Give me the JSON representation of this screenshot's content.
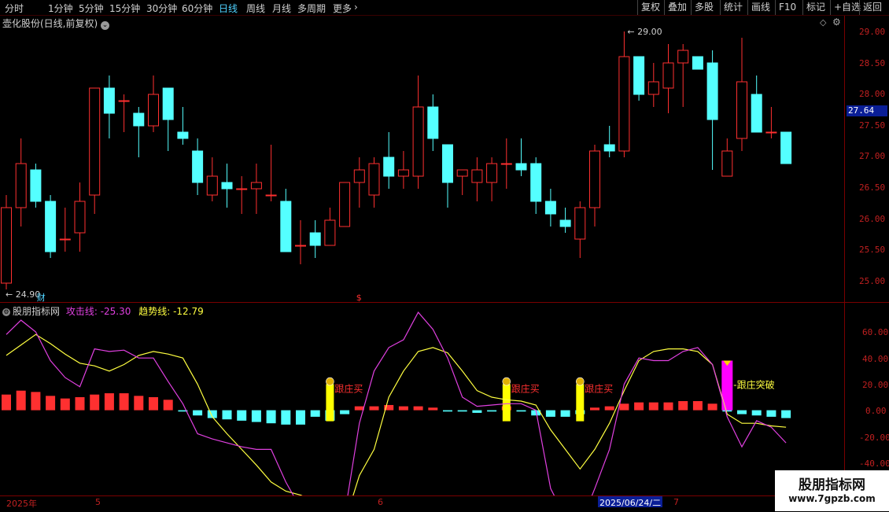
{
  "toolbar": {
    "periods": [
      "分时",
      "1分钟",
      "5分钟",
      "15分钟",
      "30分钟",
      "60分钟",
      "日线",
      "周线",
      "月线",
      "多周期",
      "更多"
    ],
    "active_period": "日线",
    "right_buttons": [
      "复权",
      "叠加",
      "多股",
      "统计",
      "画线",
      "F10",
      "标记",
      "+自选",
      "返回"
    ]
  },
  "chart_title": "壶化股份(日线,前复权)",
  "indicator": {
    "name": "股朋指标网",
    "attack_label": "攻击线: -25.30",
    "trend_label": "趋势线: -12.79",
    "signals": {
      "buy": "跟庄买",
      "breakout": "跟庄突破"
    }
  },
  "price_axis": [
    "29.00",
    "28.50",
    "28.00",
    "27.50",
    "27.00",
    "26.50",
    "26.00",
    "25.50",
    "25.00"
  ],
  "current_price": "27.64",
  "high_label": "29.00",
  "low_label": "24.90",
  "fin_marker": "财",
  "s_marker": "$",
  "ind_axis": [
    "60.00",
    "40.00",
    "20.00",
    "0.00",
    "-20.00",
    "-40.00"
  ],
  "dates": {
    "year": "2025年",
    "m5": "5",
    "m6": "6",
    "highlight": "2025/06/24/二",
    "m7": "7"
  },
  "watermark": {
    "line1": "股朋指标网",
    "line2": "www.7gpzb.com"
  },
  "colors": {
    "up": "#ff3030",
    "down": "#54ffff",
    "attack": "#e040e0",
    "trend": "#ffff40",
    "buy_bar": "#ffff00",
    "breakout_bar": "#ff00ff"
  },
  "chart_data": {
    "type": "candlestick",
    "candles": [
      {
        "o": 25.0,
        "h": 26.4,
        "l": 24.9,
        "c": 26.2
      },
      {
        "o": 26.2,
        "h": 27.3,
        "l": 25.9,
        "c": 26.9
      },
      {
        "o": 26.8,
        "h": 26.9,
        "l": 26.2,
        "c": 26.3
      },
      {
        "o": 26.3,
        "h": 26.4,
        "l": 25.4,
        "c": 25.5
      },
      {
        "o": 25.7,
        "h": 26.2,
        "l": 25.5,
        "c": 25.7
      },
      {
        "o": 25.8,
        "h": 26.6,
        "l": 25.5,
        "c": 26.3
      },
      {
        "o": 26.4,
        "h": 28.1,
        "l": 26.1,
        "c": 28.1
      },
      {
        "o": 28.1,
        "h": 28.3,
        "l": 27.3,
        "c": 27.7
      },
      {
        "o": 27.9,
        "h": 28.0,
        "l": 27.4,
        "c": 27.9
      },
      {
        "o": 27.7,
        "h": 27.8,
        "l": 27.0,
        "c": 27.5
      },
      {
        "o": 27.5,
        "h": 28.3,
        "l": 27.4,
        "c": 28.0
      },
      {
        "o": 28.1,
        "h": 28.1,
        "l": 27.1,
        "c": 27.6
      },
      {
        "o": 27.4,
        "h": 27.8,
        "l": 27.2,
        "c": 27.3
      },
      {
        "o": 27.1,
        "h": 27.3,
        "l": 26.4,
        "c": 26.6
      },
      {
        "o": 26.4,
        "h": 27.0,
        "l": 26.3,
        "c": 26.7
      },
      {
        "o": 26.6,
        "h": 26.9,
        "l": 26.2,
        "c": 26.5
      },
      {
        "o": 26.5,
        "h": 26.7,
        "l": 26.1,
        "c": 26.5
      },
      {
        "o": 26.5,
        "h": 26.9,
        "l": 26.1,
        "c": 26.6
      },
      {
        "o": 26.4,
        "h": 27.2,
        "l": 26.3,
        "c": 26.4
      },
      {
        "o": 26.3,
        "h": 26.5,
        "l": 25.5,
        "c": 25.5
      },
      {
        "o": 25.6,
        "h": 26.0,
        "l": 25.3,
        "c": 25.6
      },
      {
        "o": 25.8,
        "h": 26.0,
        "l": 25.4,
        "c": 25.6
      },
      {
        "o": 25.6,
        "h": 26.2,
        "l": 25.6,
        "c": 26.0
      },
      {
        "o": 25.9,
        "h": 26.6,
        "l": 25.9,
        "c": 26.6
      },
      {
        "o": 26.6,
        "h": 27.0,
        "l": 26.2,
        "c": 26.8
      },
      {
        "o": 26.4,
        "h": 27.0,
        "l": 26.2,
        "c": 26.9
      },
      {
        "o": 27.0,
        "h": 27.4,
        "l": 26.5,
        "c": 26.7
      },
      {
        "o": 26.7,
        "h": 27.1,
        "l": 26.5,
        "c": 26.8
      },
      {
        "o": 26.7,
        "h": 28.3,
        "l": 26.5,
        "c": 27.8
      },
      {
        "o": 27.8,
        "h": 28.0,
        "l": 27.1,
        "c": 27.3
      },
      {
        "o": 27.2,
        "h": 27.2,
        "l": 26.2,
        "c": 26.6
      },
      {
        "o": 26.7,
        "h": 26.8,
        "l": 26.4,
        "c": 26.8
      },
      {
        "o": 26.6,
        "h": 27.0,
        "l": 26.3,
        "c": 26.8
      },
      {
        "o": 26.6,
        "h": 27.0,
        "l": 26.3,
        "c": 26.9
      },
      {
        "o": 26.9,
        "h": 27.3,
        "l": 26.5,
        "c": 26.9
      },
      {
        "o": 26.9,
        "h": 27.3,
        "l": 26.7,
        "c": 26.8
      },
      {
        "o": 26.9,
        "h": 27.0,
        "l": 26.1,
        "c": 26.3
      },
      {
        "o": 26.3,
        "h": 26.5,
        "l": 25.9,
        "c": 26.1
      },
      {
        "o": 26.0,
        "h": 26.2,
        "l": 25.8,
        "c": 25.9
      },
      {
        "o": 25.7,
        "h": 26.3,
        "l": 25.4,
        "c": 26.2
      },
      {
        "o": 26.2,
        "h": 27.2,
        "l": 25.9,
        "c": 27.1
      },
      {
        "o": 27.2,
        "h": 27.5,
        "l": 27.0,
        "c": 27.1
      },
      {
        "o": 27.1,
        "h": 29.0,
        "l": 27.0,
        "c": 28.6
      },
      {
        "o": 28.6,
        "h": 28.6,
        "l": 27.9,
        "c": 28.0
      },
      {
        "o": 28.0,
        "h": 28.5,
        "l": 27.8,
        "c": 28.2
      },
      {
        "o": 28.1,
        "h": 28.8,
        "l": 27.7,
        "c": 28.5
      },
      {
        "o": 28.5,
        "h": 28.8,
        "l": 27.8,
        "c": 28.7
      },
      {
        "o": 28.6,
        "h": 28.6,
        "l": 28.4,
        "c": 28.4
      },
      {
        "o": 28.5,
        "h": 28.7,
        "l": 26.8,
        "c": 27.6
      },
      {
        "o": 26.7,
        "h": 27.3,
        "l": 26.7,
        "c": 27.1
      },
      {
        "o": 27.3,
        "h": 28.9,
        "l": 27.1,
        "c": 28.2
      },
      {
        "o": 28.0,
        "h": 28.3,
        "l": 27.4,
        "c": 27.4
      },
      {
        "o": 27.4,
        "h": 27.8,
        "l": 27.3,
        "c": 27.4
      },
      {
        "o": 27.4,
        "h": 27.4,
        "l": 26.9,
        "c": 26.9
      }
    ],
    "attack_line": [
      58,
      69,
      60,
      38,
      25,
      18,
      47,
      45,
      46,
      40,
      40,
      22,
      5,
      -18,
      -22,
      -25,
      -28,
      -30,
      -30,
      -55,
      -75,
      -78,
      -79,
      -80,
      -10,
      30,
      48,
      54,
      75,
      62,
      40,
      10,
      3,
      4,
      5,
      5,
      0,
      -60,
      -82,
      -88,
      -60,
      -30,
      20,
      40,
      38,
      38,
      45,
      48,
      35,
      -5,
      -28,
      -8,
      -13,
      -25
    ],
    "trend_line": [
      42,
      50,
      58,
      51,
      43,
      36,
      34,
      30,
      35,
      42,
      45,
      43,
      40,
      20,
      -5,
      -18,
      -30,
      -42,
      -55,
      -62,
      -65,
      -70,
      -85,
      -86,
      -50,
      -30,
      10,
      30,
      45,
      48,
      44,
      30,
      15,
      10,
      8,
      7,
      4,
      -15,
      -30,
      -45,
      -30,
      -10,
      15,
      38,
      45,
      47,
      47,
      45,
      35,
      -3,
      -10,
      -10,
      -12,
      -13
    ],
    "histogram": [
      12,
      15,
      14,
      11,
      9,
      10,
      12,
      13,
      13,
      11,
      10,
      8,
      -1,
      -4,
      -6,
      -7,
      -8,
      -9,
      -10,
      -11,
      -11,
      -5,
      -8,
      -3,
      3,
      3,
      4,
      3,
      3,
      2,
      -1,
      -1,
      -2,
      -1,
      3,
      -1,
      -4,
      -5,
      -5,
      -3,
      2,
      3,
      5,
      6,
      6,
      6,
      7,
      7,
      5,
      -1,
      -3,
      -4,
      -5,
      -6
    ],
    "buy_signals": [
      22,
      34,
      39
    ],
    "breakout_signals": [
      49
    ],
    "ylim": [
      25.0,
      29.0
    ],
    "ind_ylim": [
      -40,
      60
    ]
  }
}
